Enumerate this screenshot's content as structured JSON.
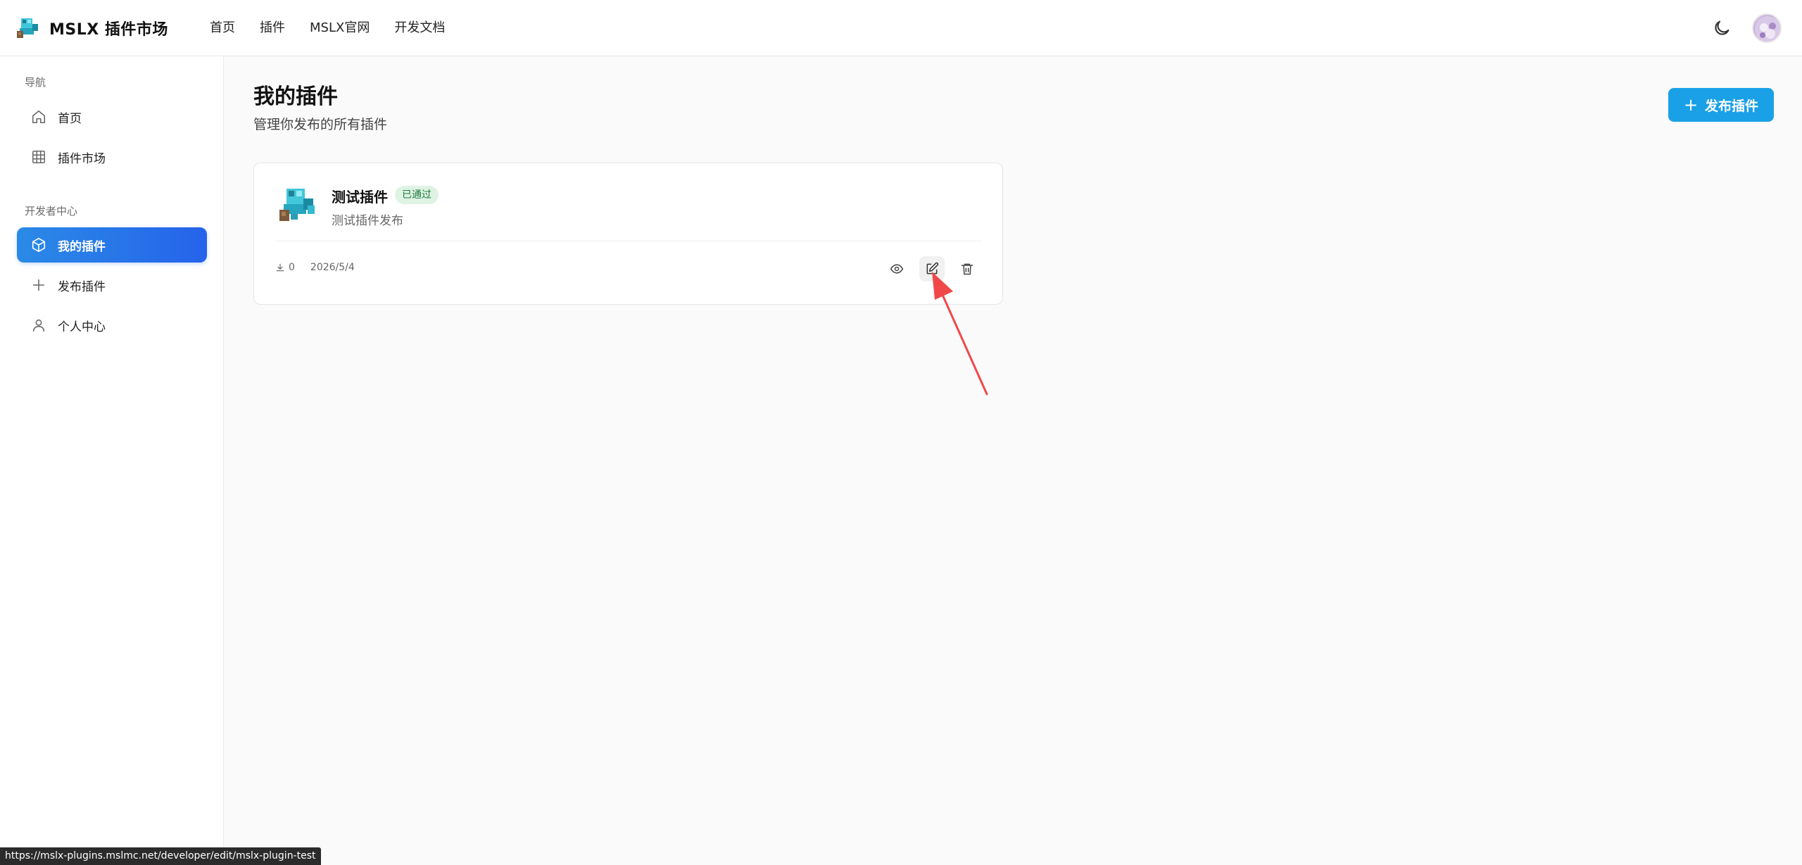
{
  "header": {
    "brand_title": "MSLX 插件市场",
    "brand_icon": "mslx-logo-icon",
    "nav": [
      "首页",
      "插件",
      "MSLX官网",
      "开发文档"
    ],
    "theme_icon": "moon-icon",
    "avatar_icon": "user-avatar"
  },
  "sidebar": {
    "section_nav": "导航",
    "nav_items": [
      {
        "label": "首页",
        "icon": "home-icon"
      },
      {
        "label": "插件市场",
        "icon": "grid-icon"
      }
    ],
    "section_dev": "开发者中心",
    "dev_items": [
      {
        "label": "我的插件",
        "icon": "package-icon",
        "active": true
      },
      {
        "label": "发布插件",
        "icon": "plus-icon"
      },
      {
        "label": "个人中心",
        "icon": "user-icon"
      }
    ]
  },
  "main": {
    "title": "我的插件",
    "subtitle": "管理你发布的所有插件",
    "publish_button": "发布插件"
  },
  "plugins": [
    {
      "name": "测试插件",
      "status": "已通过",
      "description": "测试插件发布",
      "downloads": "0",
      "date": "2026/5/4",
      "actions": [
        "eye-icon",
        "edit-icon",
        "trash-icon"
      ]
    }
  ],
  "status_bar": {
    "url": "https://mslx-plugins.mslmc.net/developer/edit/mslx-plugin-test"
  },
  "colors": {
    "accent": "#2563eb",
    "publish_button": "#1aa0e6",
    "badge_bg": "#dff3e4",
    "badge_text": "#1f7a3d",
    "annotation_arrow": "#f04848"
  }
}
